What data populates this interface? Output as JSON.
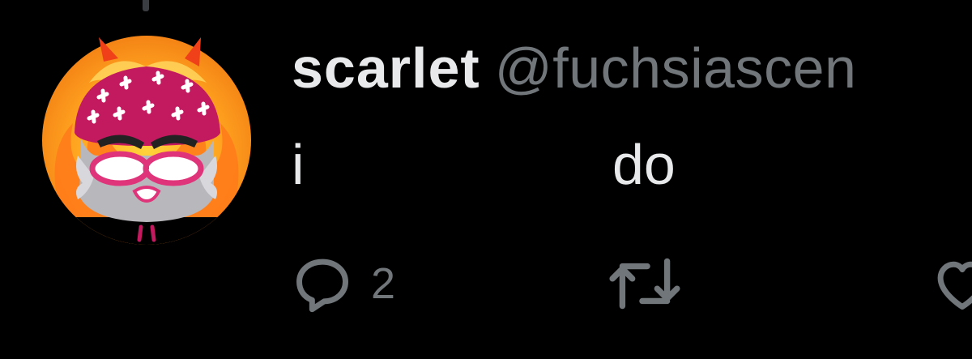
{
  "tweet": {
    "display_name": "scarlet",
    "handle": "@fuchsiascen",
    "text_part_1": "i",
    "text_part_2": "do"
  },
  "actions": {
    "reply_count": "2",
    "reply_icon": "reply-icon",
    "retweet_icon": "retweet-icon",
    "like_icon": "heart-icon"
  },
  "colors": {
    "background": "#000000",
    "primary_text": "#e7e9ea",
    "secondary_text": "#71767b"
  }
}
